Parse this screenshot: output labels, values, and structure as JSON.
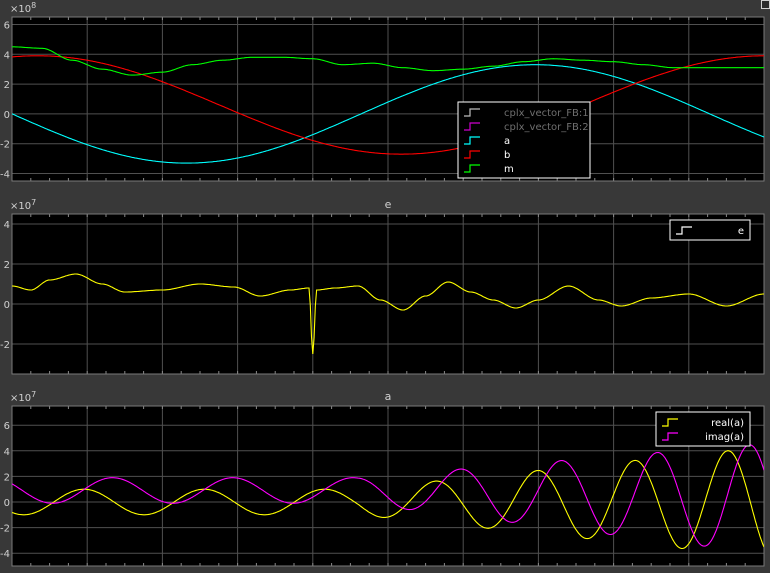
{
  "chart_data": [
    {
      "type": "line",
      "title": "",
      "exponent": "×10^8",
      "ylim": [
        -4.5,
        6.5
      ],
      "yticks": [
        -4,
        -2,
        0,
        2,
        4,
        6
      ],
      "xlim": [
        0,
        10
      ],
      "series": [
        {
          "name": "a",
          "color": "#00ffff",
          "kind": "sine",
          "amp": 3.3,
          "offset": 0,
          "freq": 0.49,
          "phase": 3.14
        },
        {
          "name": "b",
          "color": "#ff0000",
          "kind": "sine",
          "amp": 3.3,
          "offset": 0.6,
          "freq": 0.47,
          "phase": 1.35
        },
        {
          "name": "m",
          "color": "#00ff00",
          "points": [
            [
              0,
              4.5
            ],
            [
              0.4,
              4.4
            ],
            [
              0.8,
              3.6
            ],
            [
              1.2,
              3.0
            ],
            [
              1.6,
              2.6
            ],
            [
              2.0,
              2.8
            ],
            [
              2.4,
              3.3
            ],
            [
              2.8,
              3.6
            ],
            [
              3.2,
              3.8
            ],
            [
              3.6,
              3.8
            ],
            [
              4.0,
              3.7
            ],
            [
              4.4,
              3.3
            ],
            [
              4.8,
              3.4
            ],
            [
              5.2,
              3.1
            ],
            [
              5.6,
              2.9
            ],
            [
              6.0,
              3.0
            ],
            [
              6.4,
              3.2
            ],
            [
              6.8,
              3.5
            ],
            [
              7.2,
              3.7
            ],
            [
              7.6,
              3.6
            ],
            [
              8.0,
              3.5
            ],
            [
              8.4,
              3.3
            ],
            [
              8.8,
              3.1
            ],
            [
              9.2,
              3.1
            ],
            [
              9.6,
              3.1
            ],
            [
              10,
              3.1
            ]
          ]
        }
      ],
      "legend": {
        "placement": "bottom-right",
        "entries": [
          {
            "label": "cplx_vector_FB:1",
            "color": "#ffffff",
            "dim": true
          },
          {
            "label": "cplx_vector_FB:2",
            "color": "#cc00cc",
            "dim": true
          },
          {
            "label": "a",
            "color": "#00ffff"
          },
          {
            "label": "b",
            "color": "#ff0000"
          },
          {
            "label": "m",
            "color": "#00ff00"
          }
        ]
      }
    },
    {
      "type": "line",
      "title": "e",
      "exponent": "×10^7",
      "ylim": [
        -3.5,
        4.5
      ],
      "yticks": [
        -2,
        0,
        2,
        4
      ],
      "xlim": [
        0,
        10
      ],
      "series": [
        {
          "name": "e",
          "color": "#ffff00",
          "points": [
            [
              0,
              0.9
            ],
            [
              0.25,
              0.7
            ],
            [
              0.5,
              1.2
            ],
            [
              0.85,
              1.5
            ],
            [
              1.2,
              1.0
            ],
            [
              1.5,
              0.6
            ],
            [
              2.0,
              0.7
            ],
            [
              2.5,
              1.0
            ],
            [
              2.95,
              0.85
            ],
            [
              3.3,
              0.4
            ],
            [
              3.7,
              0.7
            ],
            [
              3.95,
              0.8
            ],
            [
              4.0,
              -2.5
            ],
            [
              4.05,
              0.7
            ],
            [
              4.3,
              0.8
            ],
            [
              4.6,
              0.9
            ],
            [
              4.9,
              0.2
            ],
            [
              5.2,
              -0.3
            ],
            [
              5.5,
              0.4
            ],
            [
              5.8,
              1.1
            ],
            [
              6.1,
              0.6
            ],
            [
              6.4,
              0.2
            ],
            [
              6.7,
              -0.2
            ],
            [
              7.0,
              0.2
            ],
            [
              7.4,
              0.9
            ],
            [
              7.8,
              0.2
            ],
            [
              8.1,
              -0.1
            ],
            [
              8.5,
              0.3
            ],
            [
              9.0,
              0.5
            ],
            [
              9.5,
              -0.1
            ],
            [
              10.0,
              0.5
            ]
          ]
        }
      ],
      "legend": {
        "placement": "top-right",
        "entries": [
          {
            "label": "e",
            "color": "#ffffff"
          }
        ]
      }
    },
    {
      "type": "line",
      "title": "a",
      "exponent": "×10^7",
      "ylim": [
        -5.0,
        7.5
      ],
      "yticks": [
        -4,
        -2,
        0,
        2,
        4,
        6
      ],
      "xlim": [
        0,
        10
      ],
      "series": [
        {
          "name": "real(a)",
          "color": "#ffff00",
          "kind": "growing-sine",
          "amp0": 1.0,
          "amp1": 4.3,
          "growStart": 4.6,
          "offset": 0,
          "freq": 1.25,
          "phase": 4.1
        },
        {
          "name": "imag(a)",
          "color": "#ff00ff",
          "kind": "growing-sine",
          "amp0": 1.0,
          "amp1": 4.3,
          "growStart": 4.6,
          "offset": 0.9,
          "freq": 1.25,
          "phase": 2.6
        }
      ],
      "legend": {
        "placement": "top-right",
        "entries": [
          {
            "label": "real(a)",
            "color": "#ffff00"
          },
          {
            "label": "imag(a)",
            "color": "#ff00ff"
          }
        ]
      }
    }
  ]
}
